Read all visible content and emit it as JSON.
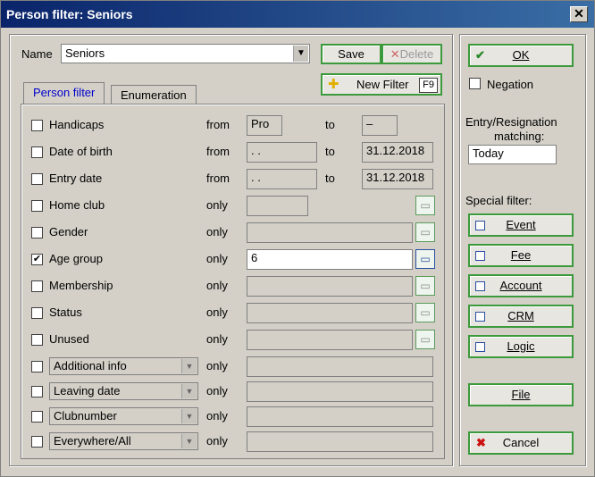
{
  "window": {
    "title": "Person filter: Seniors",
    "close": "✕"
  },
  "name_row": {
    "label": "Name",
    "value": "Seniors",
    "save": "Save",
    "delete": "Delete",
    "new_filter": "New Filter",
    "new_filter_key": "F9"
  },
  "tabs": [
    "Person filter",
    "Enumeration"
  ],
  "rows": [
    {
      "label": "Handicaps",
      "mode": "from",
      "from": "Pro",
      "to_label": "to",
      "to": "–",
      "checked": false
    },
    {
      "label": "Date of birth",
      "mode": "from",
      "from": " .  .",
      "to_label": "to",
      "to": "31.12.2018",
      "checked": false
    },
    {
      "label": "Entry date",
      "mode": "from",
      "from": " .  .",
      "to_label": "to",
      "to": "31.12.2018",
      "checked": false
    },
    {
      "label": "Home club",
      "mode": "only",
      "value": "",
      "checked": false
    },
    {
      "label": "Gender",
      "mode": "only",
      "value": "",
      "checked": false
    },
    {
      "label": "Age group",
      "mode": "only",
      "value": "6",
      "checked": true
    },
    {
      "label": "Membership",
      "mode": "only",
      "value": "",
      "checked": false
    },
    {
      "label": "Status",
      "mode": "only",
      "value": "",
      "checked": false
    },
    {
      "label": "Unused",
      "mode": "only",
      "value": "",
      "checked": false
    },
    {
      "label": "Additional info",
      "mode": "only",
      "value": "",
      "checked": false
    },
    {
      "label": "Leaving date",
      "mode": "only",
      "value": "",
      "checked": false
    },
    {
      "label": "Clubnumber",
      "mode": "only",
      "value": "",
      "checked": false
    },
    {
      "label": "Everywhere/All",
      "mode": "only",
      "value": "",
      "checked": false
    }
  ],
  "right": {
    "ok": "OK",
    "negation": "Negation",
    "matching_label_1": "Entry/Resignation",
    "matching_label_2": "matching:",
    "matching_value": "Today",
    "special_label": "Special filter:",
    "special": [
      "Event",
      "Fee",
      "Account",
      "CRM",
      "Logic"
    ],
    "file": "File",
    "cancel": "Cancel"
  },
  "colors": {
    "titlebar": "#0a246a",
    "accent_green": "#3c9a3c",
    "cancel_red": "#cc1111"
  }
}
